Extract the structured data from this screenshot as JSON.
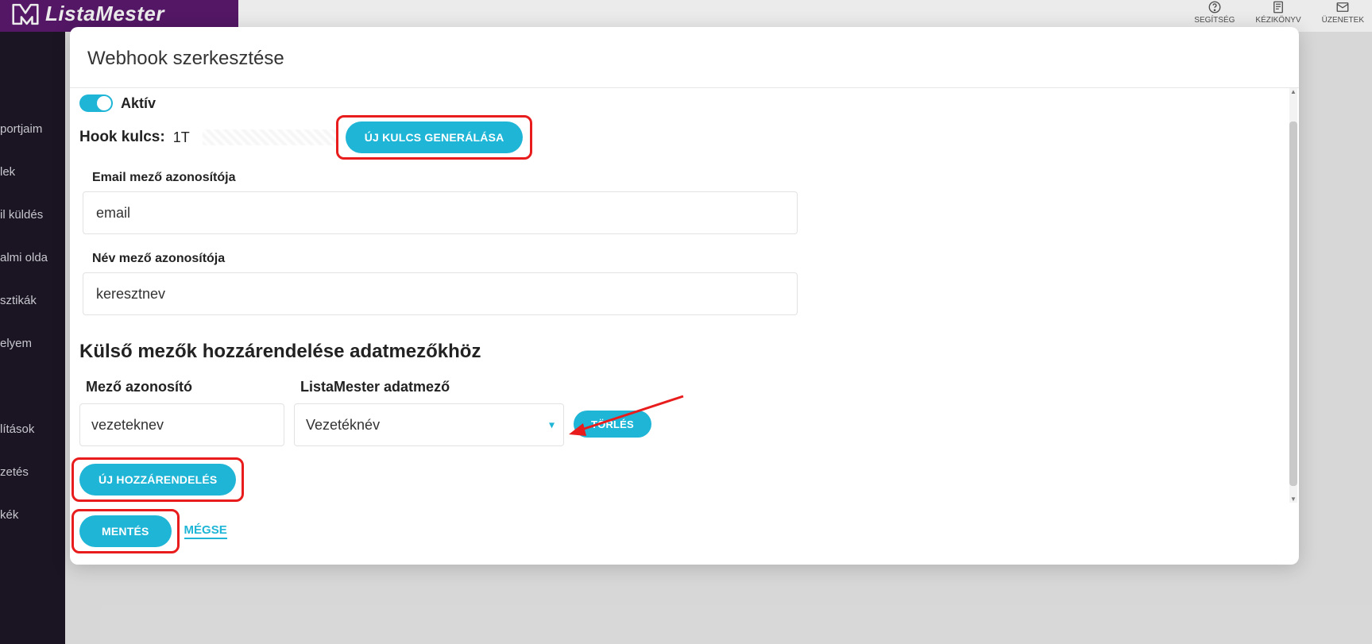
{
  "app": {
    "brand": "ListaMester",
    "header_right": [
      {
        "label": "SEGÍTSÉG"
      },
      {
        "label": "KÉZIKÖNYV"
      },
      {
        "label": "ÜZENETEK"
      }
    ],
    "sidebar_items": [
      "portjaim",
      "lek",
      "il küldés",
      "almi olda",
      "sztikák",
      "elyem",
      "",
      "lítások",
      "zetés",
      "kék"
    ]
  },
  "modal": {
    "title": "Webhook szerkesztése",
    "active_label": "Aktív",
    "hook_key_label": "Hook kulcs:",
    "hook_key_value": "1T",
    "gen_key_btn": "ÚJ KULCS GENERÁLÁSA",
    "email_field_label": "Email mező azonosítója",
    "email_field_value": "email",
    "name_field_label": "Név mező azonosítója",
    "name_field_value": "keresztnev",
    "mapping_heading": "Külső mezők hozzárendelése adatmezőkhöz",
    "mapping_col_a": "Mező azonosító",
    "mapping_col_b": "ListaMester adatmező",
    "mapping_row": {
      "id": "vezeteknev",
      "target": "Vezetéknév"
    },
    "delete_btn": "TÖRLÉS",
    "new_map_btn": "ÚJ HOZZÁRENDELÉS",
    "save_btn": "MENTÉS",
    "cancel_btn": "MÉGSE"
  }
}
